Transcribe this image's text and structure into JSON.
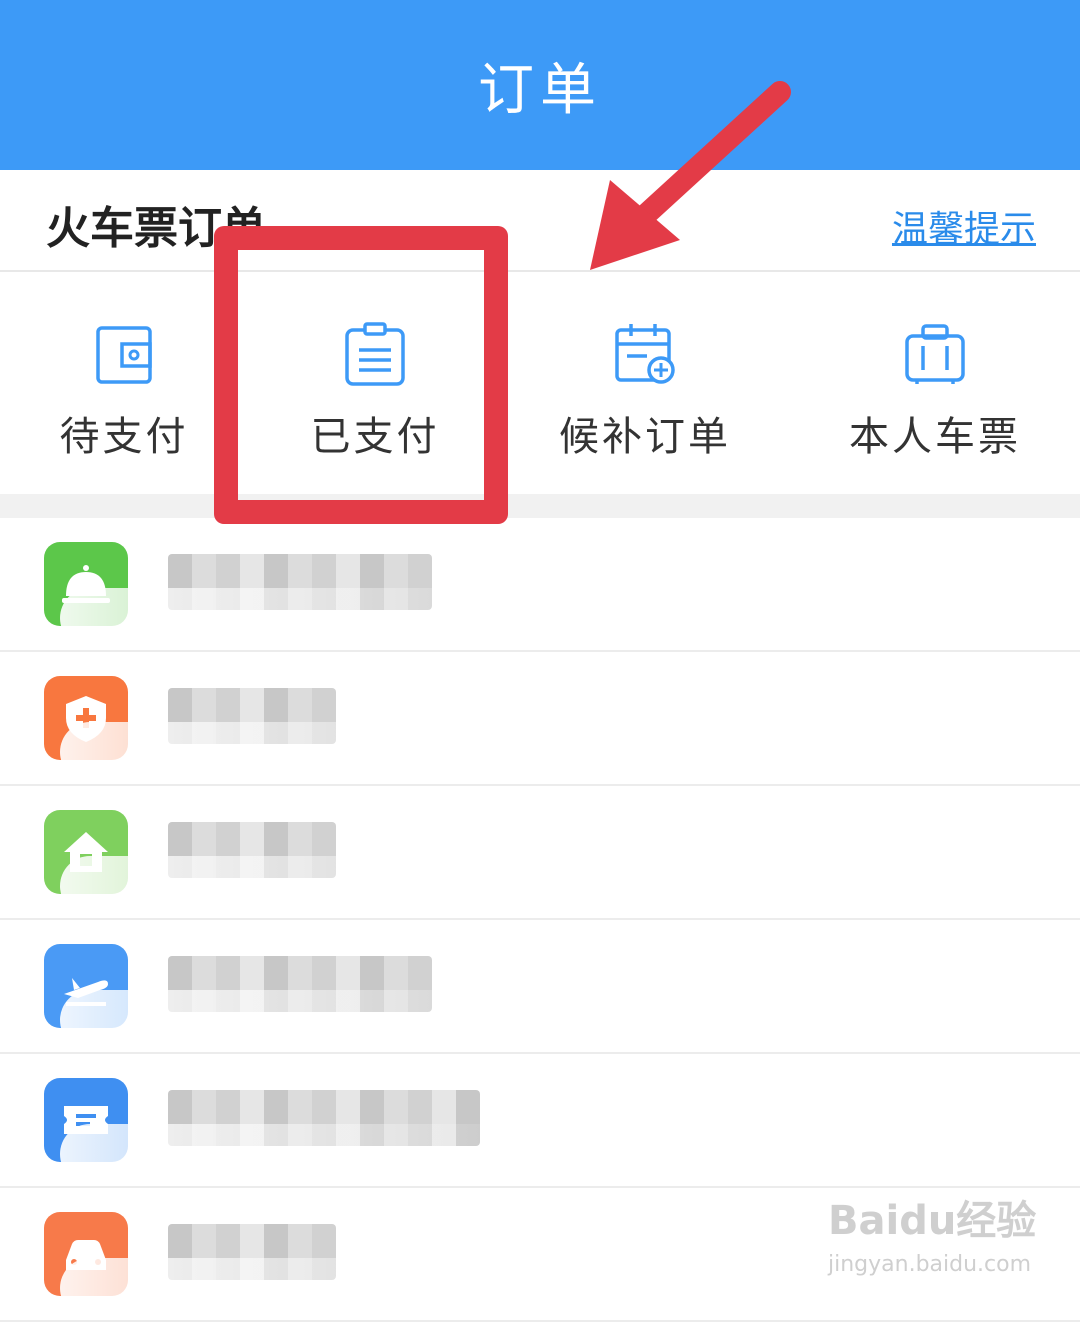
{
  "header": {
    "title": "订单"
  },
  "section": {
    "title": "火车票订单",
    "tip_link": "温馨提示"
  },
  "tabs": [
    {
      "label": "待支付",
      "icon": "wallet-icon"
    },
    {
      "label": "已支付",
      "icon": "clipboard-list-icon"
    },
    {
      "label": "候补订单",
      "icon": "calendar-add-icon"
    },
    {
      "label": "本人车票",
      "icon": "suitcase-icon"
    }
  ],
  "services": [
    {
      "icon": "service-bell-icon",
      "color": "#5cc74a"
    },
    {
      "icon": "shield-cross-icon",
      "color": "#f8773f"
    },
    {
      "icon": "house-icon",
      "color": "#7fd05e"
    },
    {
      "icon": "airplane-icon",
      "color": "#4a9af5"
    },
    {
      "icon": "ticket-icon",
      "color": "#3f8ff1"
    },
    {
      "icon": "car-icon",
      "color": "#f77a4a"
    }
  ],
  "colors": {
    "header": "#3d9af7",
    "highlight": "#e33b47",
    "link": "#2a8bea"
  },
  "watermark": {
    "brand": "Baidu经验",
    "domain": "jingyan.baidu.com"
  }
}
